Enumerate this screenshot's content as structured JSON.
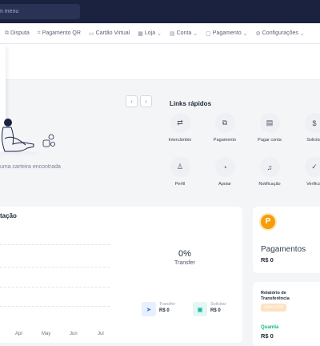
{
  "search": {
    "text": "m menu"
  },
  "nav": [
    {
      "icon": "dispute-icon",
      "label": "Disputa",
      "has_menu": false
    },
    {
      "icon": "qr-code-icon",
      "label": "Pagamento QR",
      "has_menu": false
    },
    {
      "icon": "card-icon",
      "label": "Cartão Virtual",
      "has_menu": false
    },
    {
      "icon": "store-icon",
      "label": "Loja",
      "has_menu": true
    },
    {
      "icon": "account-icon",
      "label": "Conta",
      "has_menu": true
    },
    {
      "icon": "payment-icon",
      "label": "Pagamento",
      "has_menu": true
    },
    {
      "icon": "settings-icon",
      "label": "Configurações",
      "has_menu": true
    }
  ],
  "wallet": {
    "empty_text": "uma carteira encontrada"
  },
  "quick_links": {
    "title": "Links rápidos",
    "items": [
      {
        "icon": "exchange-icon",
        "label": "Intercâmbio"
      },
      {
        "icon": "payment-icon",
        "label": "Pagamento"
      },
      {
        "icon": "bill-icon",
        "label": "Pagar conta"
      },
      {
        "icon": "dollar-icon",
        "label": "Solicitar"
      },
      {
        "icon": "user-icon",
        "label": "Perfil"
      },
      {
        "icon": "headset-icon",
        "label": "Apoiar"
      },
      {
        "icon": "bell-icon",
        "label": "Notificação"
      },
      {
        "icon": "verify-user-icon",
        "label": "Verificar"
      }
    ]
  },
  "chart": {
    "title": "tação",
    "months": [
      "Apr",
      "May",
      "Jun",
      "Jul"
    ],
    "percent": "0%",
    "percent_label": "Transfer",
    "legend": [
      {
        "icon": "send-icon",
        "label": "Transfer",
        "value": "R$ 0",
        "color": "#3b82f6",
        "bg": "#e8efff"
      },
      {
        "icon": "inbox-icon",
        "label": "Solicitar",
        "value": "R$ 0",
        "color": "#14b8a6",
        "bg": "#e3f7f4"
      }
    ]
  },
  "payments": {
    "coin": "P",
    "title": "Pagamentos",
    "value": "R$ 0"
  },
  "report": {
    "title": "Relatório de Transferência",
    "badge": "Julho 2025",
    "qty_label": "Quantia",
    "value": "R$ 0"
  }
}
